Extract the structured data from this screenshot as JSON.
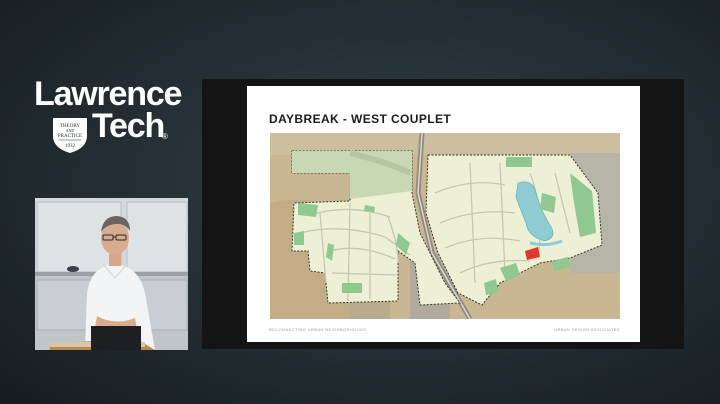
{
  "logo": {
    "line1": "Lawrence",
    "line2": "Tech",
    "registered": "®",
    "seal_text": "THEORY AND PRACTICE 1932"
  },
  "slide": {
    "title": "DAYBREAK - WEST COUPLET",
    "footer_left": "RECONNECTING URBAN NEIGHBORHOODS",
    "footer_right": "URBAN DESIGN ASSOCIATES"
  },
  "colors": {
    "background": "#222c32",
    "slide_frame": "#141414",
    "map_base": "#c9b693",
    "lot": "#eef0d6",
    "park": "#8fc890",
    "water": "#8fcbd2",
    "highlight": "#e0382a"
  }
}
